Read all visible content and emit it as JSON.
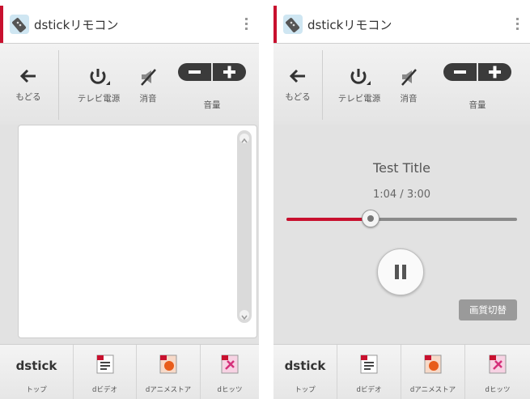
{
  "app": {
    "title": "dstickリモコン"
  },
  "controls": {
    "back": "もどる",
    "tv_power": "テレビ電源",
    "mute": "消音",
    "volume": "音量"
  },
  "player": {
    "title": "Test Title",
    "time_current": "1:04",
    "time_separator": "/",
    "time_total": "3:00",
    "progress_fraction": 0.36,
    "quality_button": "画質切替"
  },
  "bottom_nav": {
    "logo": "dstick",
    "items": [
      "トップ",
      "dビデオ",
      "dアニメストア",
      "dヒッツ"
    ]
  },
  "colors": {
    "accent": "#c8102e",
    "video_icon": "#c8102e",
    "anime_icon": "#e85c1a",
    "hits_icon": "#d4307a"
  }
}
